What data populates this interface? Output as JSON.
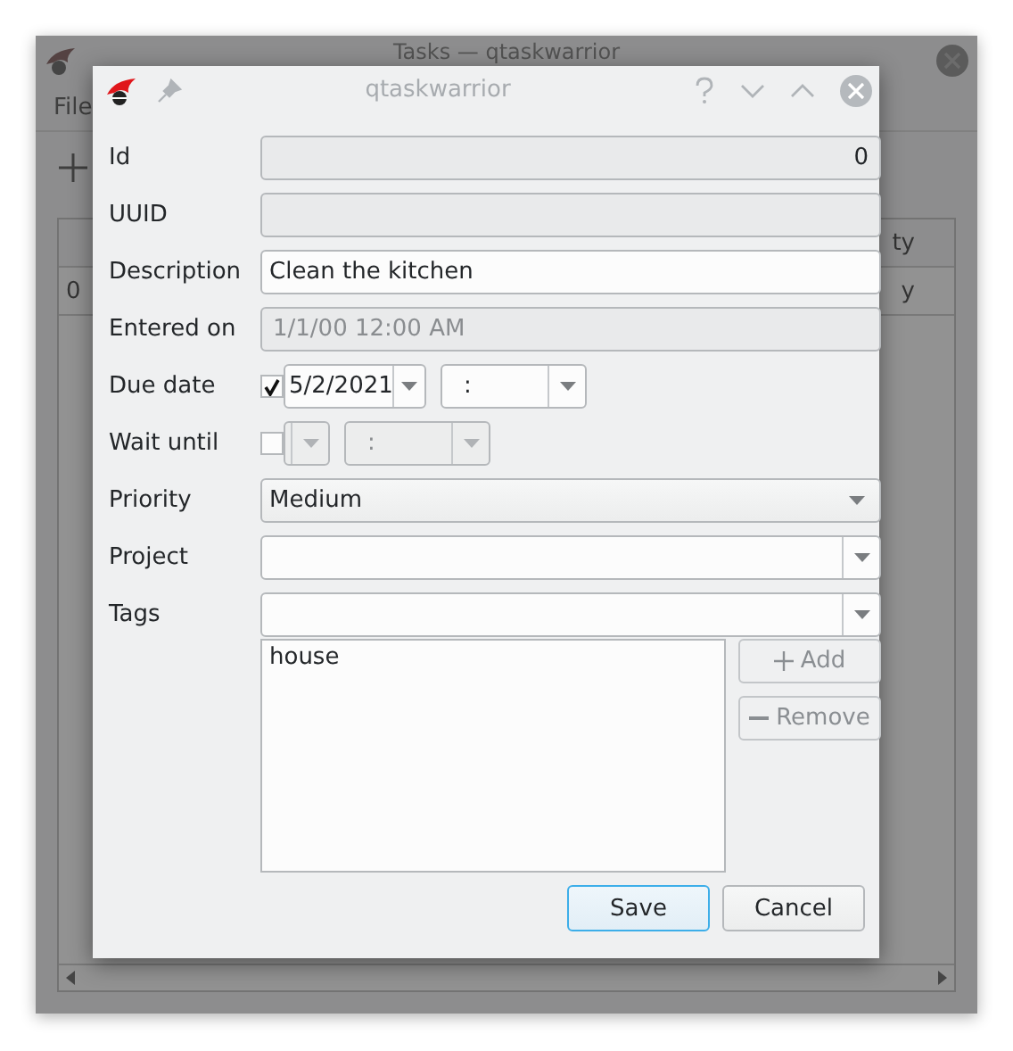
{
  "main_window": {
    "title": "Tasks — qtaskwarrior",
    "menu": [
      "File"
    ],
    "table": {
      "header": [
        "ty"
      ],
      "row": [
        "0",
        "y"
      ]
    }
  },
  "dialog": {
    "title": "qtaskwarrior",
    "fields": [
      {
        "kind": "number",
        "label": "Id",
        "value": "0"
      },
      {
        "kind": "readonly",
        "label": "UUID"
      },
      {
        "kind": "text",
        "label": "Description",
        "value": "Clean the kitchen"
      },
      {
        "kind": "disabled",
        "label": "Entered on",
        "value": "1/1/00 12:00 AM"
      },
      {
        "kind": "datetime",
        "label": "Due date",
        "checked": true,
        "date": "5/2/2021",
        "time": ":"
      },
      {
        "kind": "datetime",
        "label": "Wait until",
        "checked": false,
        "time": ":"
      },
      {
        "kind": "combo",
        "label": "Priority",
        "value": "Medium"
      },
      {
        "kind": "editcombo",
        "label": "Project"
      },
      {
        "kind": "editcombo",
        "label": "Tags"
      }
    ],
    "tags": [
      "house"
    ],
    "tag_buttons": [
      {
        "kind": "add",
        "label": "Add"
      },
      {
        "kind": "remove",
        "label": "Remove"
      }
    ],
    "buttons": [
      {
        "label": "Save",
        "default": true
      },
      {
        "label": "Cancel",
        "default": false
      }
    ]
  }
}
